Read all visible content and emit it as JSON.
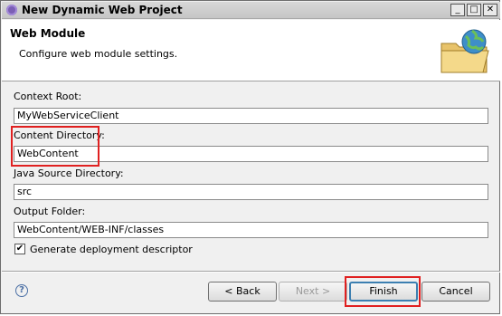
{
  "window": {
    "title": "New Dynamic Web Project",
    "minimize_glyph": "_",
    "maximize_glyph": "□",
    "close_glyph": "✕"
  },
  "banner": {
    "title": "Web Module",
    "description": "Configure web module settings."
  },
  "form": {
    "context_root": {
      "label": "Context Root:",
      "value": "MyWebServiceClient"
    },
    "content_directory": {
      "label": "Content Directory:",
      "value": "WebContent"
    },
    "java_source_directory": {
      "label": "Java Source Directory:",
      "value": "src"
    },
    "output_folder": {
      "label": "Output Folder:",
      "value": "WebContent/WEB-INF/classes"
    },
    "generate_descriptor": {
      "label": "Generate deployment descriptor",
      "checked": true,
      "check_glyph": "✔"
    }
  },
  "buttons": {
    "help_glyph": "?",
    "back": "< Back",
    "next": "Next >",
    "finish": "Finish",
    "cancel": "Cancel"
  },
  "colors": {
    "highlight": "#e02020",
    "default_button_border": "#3c7fb1"
  },
  "icons": {
    "app": "eclipse-icon",
    "banner": "folder-globe-icon",
    "help": "help-icon"
  }
}
